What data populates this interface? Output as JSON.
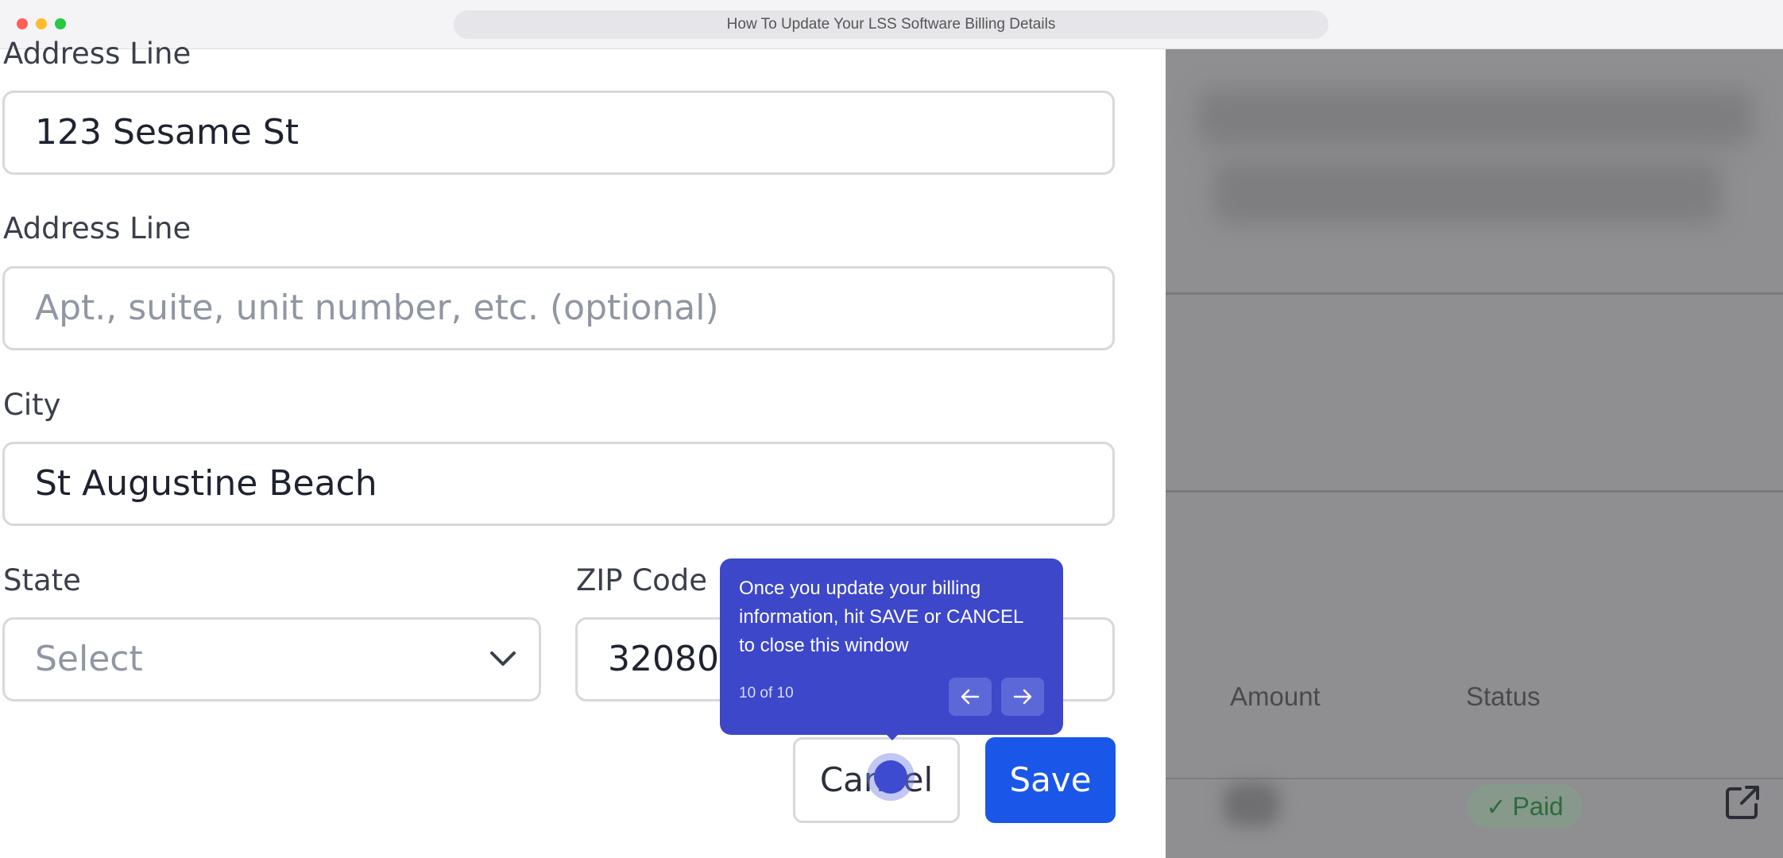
{
  "window": {
    "url_title": "How To Update Your LSS Software Billing Details"
  },
  "form": {
    "address1": {
      "label": "Address Line",
      "value": "123 Sesame St"
    },
    "address2": {
      "label": "Address Line",
      "placeholder": "Apt., suite, unit number, etc. (optional)"
    },
    "city": {
      "label": "City",
      "value": "St Augustine Beach"
    },
    "state": {
      "label": "State",
      "selected": "Select"
    },
    "zip": {
      "label": "ZIP Code",
      "value": "32080"
    },
    "cancel_label": "Cancel",
    "save_label": "Save"
  },
  "background_table": {
    "headers": [
      "Amount",
      "Status"
    ],
    "status_badge": "Paid"
  },
  "tooltip": {
    "text": "Once you update your billing information, hit SAVE or CANCEL to close this window",
    "step": "10 of 10"
  },
  "colors": {
    "accent": "#3d47c9",
    "save_button": "#1a56e8",
    "paid_badge": "#86998a"
  },
  "icons": [
    "chevron-down-icon",
    "arrow-left-icon",
    "arrow-right-icon",
    "external-link-icon",
    "check-icon"
  ]
}
